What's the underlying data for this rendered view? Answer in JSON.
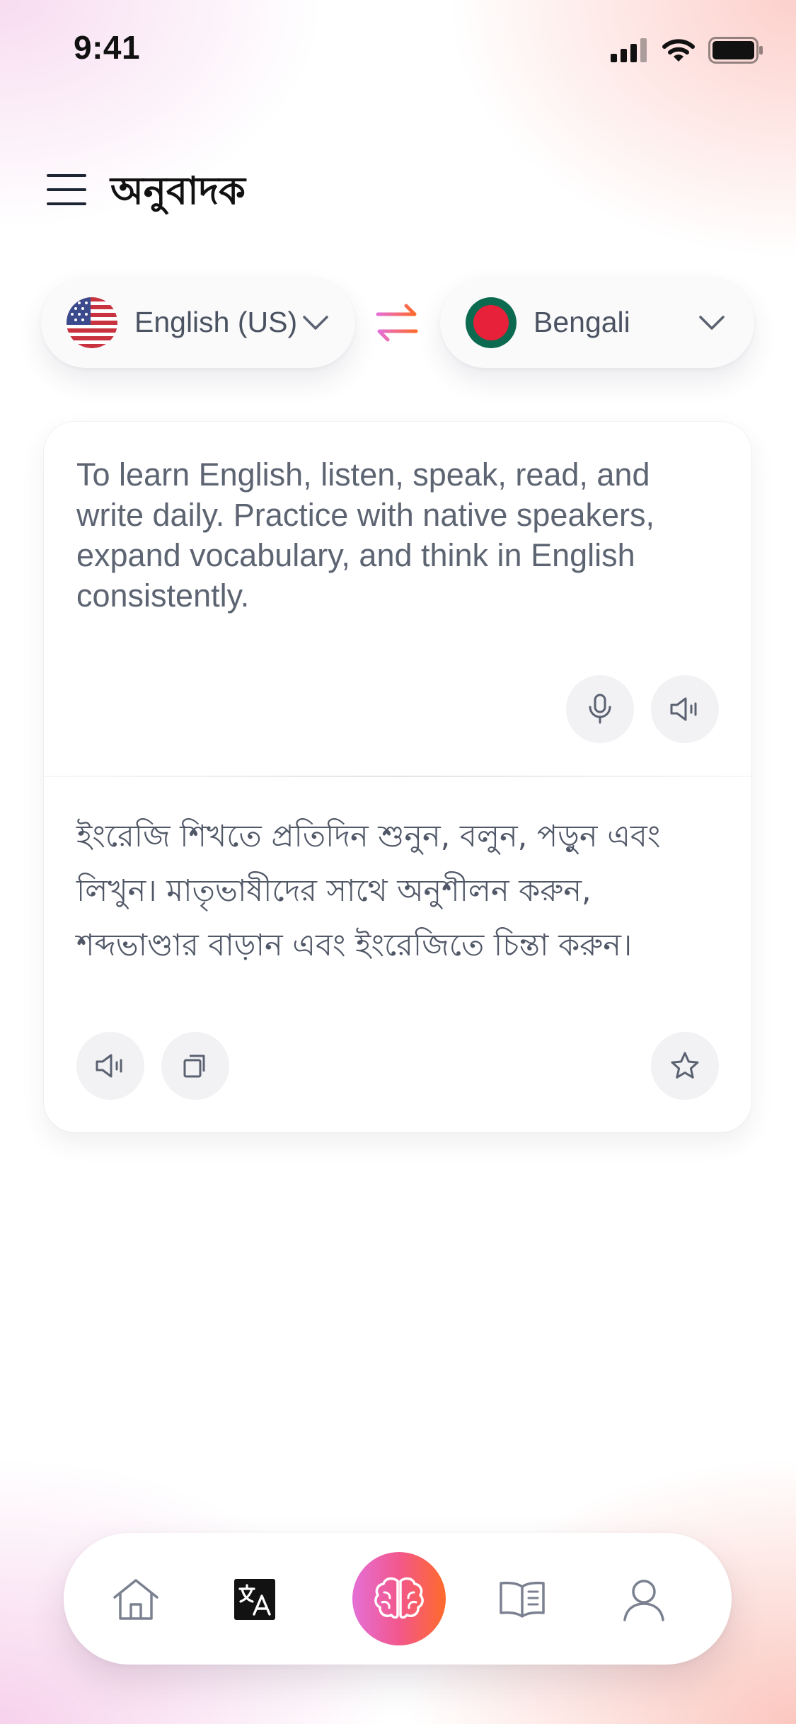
{
  "status_bar": {
    "time": "9:41"
  },
  "header": {
    "title": "অনুবাদক",
    "menu_icon": "hamburger-menu-icon"
  },
  "languages": {
    "source": {
      "label": "English (US)",
      "flag": "us-flag-icon"
    },
    "target": {
      "label": "Bengali",
      "flag": "bangladesh-flag-icon"
    },
    "swap_icon": "swap-arrows-icon"
  },
  "translation": {
    "source_text": "To learn English, listen, speak, read, and write daily. Practice with native speakers, expand vocabulary, and think in English consistently.",
    "target_text": "ইংরেজি শিখতে প্রতিদিন শুনুন, বলুন, পড়ুন এবং লিখুন। মাতৃভাষীদের সাথে অনুশীলন করুন, শব্দভাণ্ডার বাড়ান এবং ইংরেজিতে চিন্তা করুন।"
  },
  "source_actions": [
    "microphone-icon",
    "speaker-icon"
  ],
  "target_actions": [
    "speaker-icon",
    "copy-icon",
    "star-icon"
  ],
  "bottom_nav": [
    "home-icon",
    "translate-icon",
    "brain-icon",
    "book-icon",
    "profile-icon"
  ],
  "colors": {
    "accent_gradient": [
      "#e46fd6",
      "#f2578c",
      "#ff6a2a"
    ],
    "text": "#1d2433",
    "muted_text": "#5d6472"
  }
}
